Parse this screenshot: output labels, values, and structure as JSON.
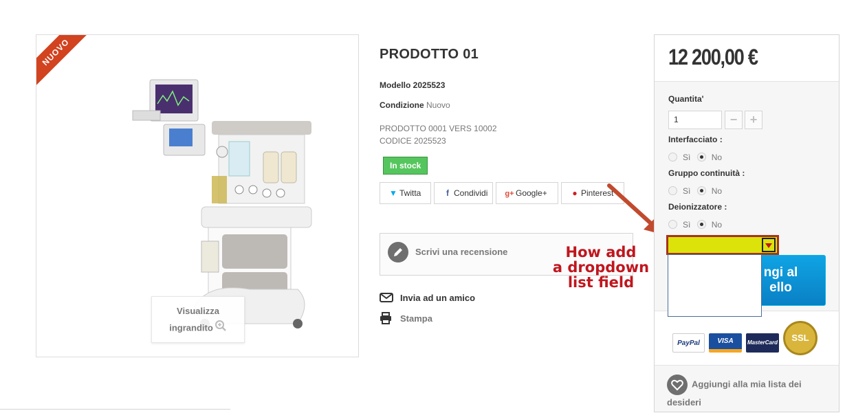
{
  "product": {
    "badge": "NUOVO",
    "zoom_line1": "Visualizza",
    "zoom_line2": "ingrandito",
    "title": "PRODOTTO 01",
    "model_label": "Modello",
    "model_value": "2025523",
    "condition_label": "Condizione",
    "condition_value": "Nuovo",
    "desc_line1": "PRODOTTO 0001 VERS 10002",
    "desc_line2": "CODICE 2025523",
    "stock": "In stock"
  },
  "share": {
    "twitter": "Twitta",
    "facebook": "Condividi",
    "google": "Google+",
    "pinterest": "Pinterest"
  },
  "review": {
    "label": "Scrivi una recensione"
  },
  "links": {
    "send_friend": "Invia ad un amico",
    "print": "Stampa"
  },
  "annotation": {
    "line1": "How add",
    "line2": "a dropdown",
    "line3": "list field"
  },
  "buy": {
    "price": "12 200,00 €",
    "quantity_label": "Quantita'",
    "quantity_value": "1",
    "minus": "−",
    "plus": "+",
    "options": [
      {
        "label": "Interfacciato :",
        "yes": "Sì",
        "no": "No",
        "selected": "No"
      },
      {
        "label": "Gruppo continuità :",
        "yes": "Sì",
        "no": "No",
        "selected": "No"
      },
      {
        "label": "Deionizzatore :",
        "yes": "Sì",
        "no": "No",
        "selected": "No"
      }
    ],
    "add_to_cart_line1": "ngi al",
    "add_to_cart_line2": "ello",
    "cards": [
      "PayPal",
      "VISA",
      "MasterCard",
      "SSL"
    ],
    "wishlist": "Aggiungi alla mia lista dei desideri"
  },
  "colors": {
    "accent": "#0a80c5",
    "stock": "#55c65e",
    "ribbon": "#d2431f",
    "annotation": "#c0161e",
    "dropdown": "#dce30a"
  }
}
